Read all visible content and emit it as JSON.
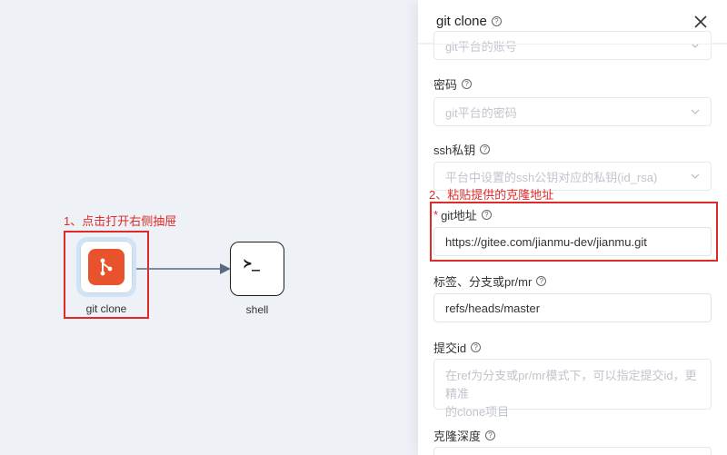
{
  "annotations": {
    "step1": "1、点击打开右侧抽屉",
    "step2": "2、粘贴提供的克隆地址"
  },
  "canvas": {
    "nodes": [
      {
        "label": "git clone",
        "icon": "git-icon"
      },
      {
        "label": "shell",
        "icon": "terminal-icon",
        "glyph": "≻_"
      }
    ]
  },
  "drawer": {
    "title": "git clone",
    "fields": {
      "account": {
        "placeholder": "git平台的账号"
      },
      "password": {
        "label": "密码",
        "placeholder": "git平台的密码"
      },
      "ssh_key": {
        "label": "ssh私钥",
        "placeholder": "平台中设置的ssh公钥对应的私钥(id_rsa)"
      },
      "git_url": {
        "required_mark": "*",
        "label": "git地址",
        "value": "https://gitee.com/jianmu-dev/jianmu.git"
      },
      "ref": {
        "label": "标签、分支或pr/mr",
        "value": "refs/heads/master"
      },
      "commit_id": {
        "label": "提交id",
        "placeholder_line1": "在ref为分支或pr/mr模式下，可以指定提交id，更精准",
        "placeholder_line2": "的clone项目"
      },
      "depth": {
        "label": "克隆深度"
      }
    }
  },
  "colors": {
    "accent_red": "#e02a2a",
    "git_orange": "#e8532e",
    "canvas_bg": "#eef1f5",
    "edge": "#5a6a82"
  }
}
